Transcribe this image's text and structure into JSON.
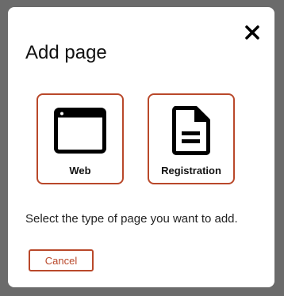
{
  "dialog": {
    "title": "Add page",
    "close_icon": "close-icon",
    "page_types": [
      {
        "label": "Web",
        "icon": "browser-window-icon"
      },
      {
        "label": "Registration",
        "icon": "document-icon"
      }
    ],
    "description": "Select the type of page you want to add.",
    "cancel_label": "Cancel"
  },
  "colors": {
    "overlay": "#6b6b6b",
    "dialog_background": "#ffffff",
    "accent": "#b9482a",
    "text": "#111111"
  }
}
